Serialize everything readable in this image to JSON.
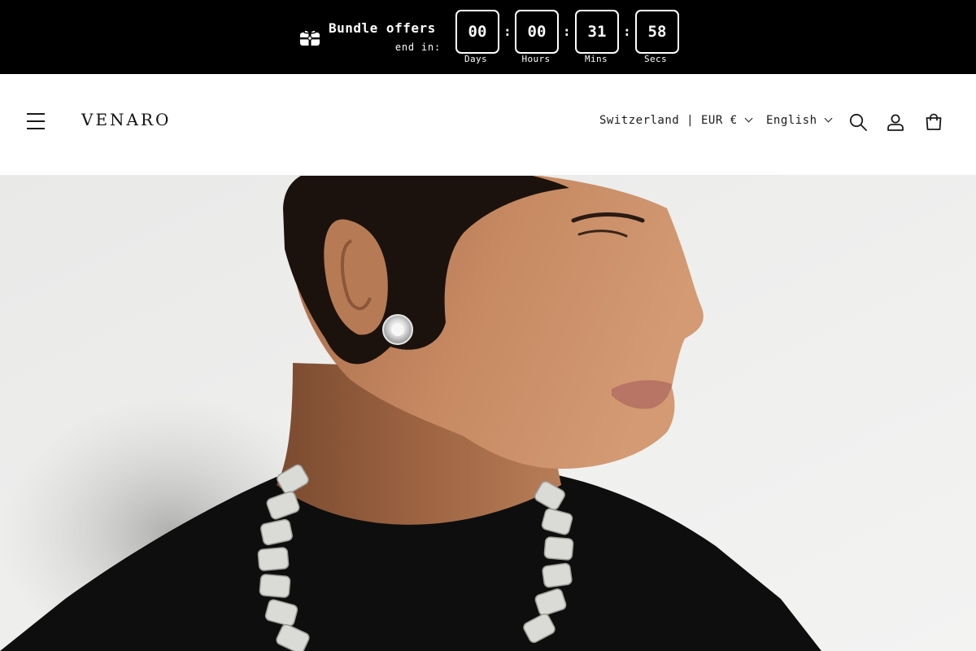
{
  "announcement": {
    "gift_icon": "gift-icon",
    "title": "Bundle offers",
    "subtitle": "end in:",
    "countdown": [
      {
        "value": "00",
        "label": "Days"
      },
      {
        "value": "00",
        "label": "Hours"
      },
      {
        "value": "31",
        "label": "Mins"
      },
      {
        "value": "58",
        "label": "Secs"
      }
    ],
    "separator": ":",
    "colors": {
      "background": "#000000",
      "text": "#ffffff"
    }
  },
  "header": {
    "menu_icon": "hamburger-menu-icon",
    "logo": "VENARO",
    "country_selector": "Switzerland | EUR €",
    "language_selector": "English",
    "icons": [
      "search-icon",
      "account-icon",
      "cart-icon"
    ]
  },
  "hero": {
    "image": "model-wearing-diamond-stud-earring-and-iced-cuban-chain"
  }
}
